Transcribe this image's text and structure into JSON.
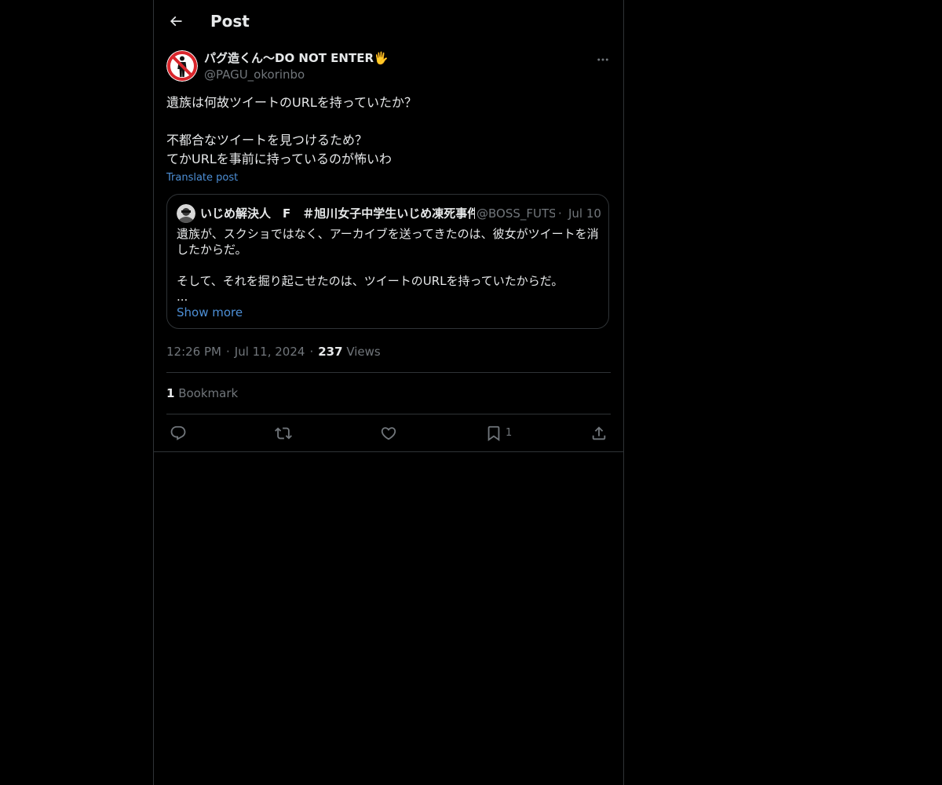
{
  "header": {
    "title": "Post"
  },
  "post": {
    "display_name": "パグ造くん〜DO NOT ENTER🖐",
    "handle": "@PAGU_okorinbo",
    "text_lines": [
      "遺族は何故ツイートのURLを持っていたか？",
      "",
      "不都合なツイートを見つけるため？",
      "てかURLを事前に持っているのが怖いわ"
    ],
    "translate_label": "Translate post",
    "time": "12:26 PM",
    "date": "Jul 11, 2024",
    "views_count": "237",
    "views_label": "Views",
    "bookmark_count": "1",
    "bookmark_label": "Bookmark"
  },
  "quote": {
    "display_name": "いじめ解決人　F　＃旭川女子中学生いじめ凍死事件",
    "handle": "@BOSS_FUTSU",
    "separator": "·",
    "date": "Jul 10",
    "text_lines": [
      "遺族が、スクショではなく、アーカイブを送ってきたのは、彼女がツイートを消",
      "したからだ。",
      "",
      "そして、それを掘り起こせたのは、ツイートのURLを持っていたからだ。",
      "..."
    ],
    "show_more_label": "Show more"
  },
  "actions": {
    "reply_icon": "reply-icon",
    "retweet_icon": "retweet-icon",
    "like_icon": "like-icon",
    "bookmark_icon": "bookmark-icon",
    "bookmark_count": "1",
    "share_icon": "share-icon"
  },
  "colors": {
    "background": "#000000",
    "text": "#e7e9ea",
    "secondary": "#71767b",
    "link": "#4d8fd6",
    "border": "#2f3336"
  }
}
